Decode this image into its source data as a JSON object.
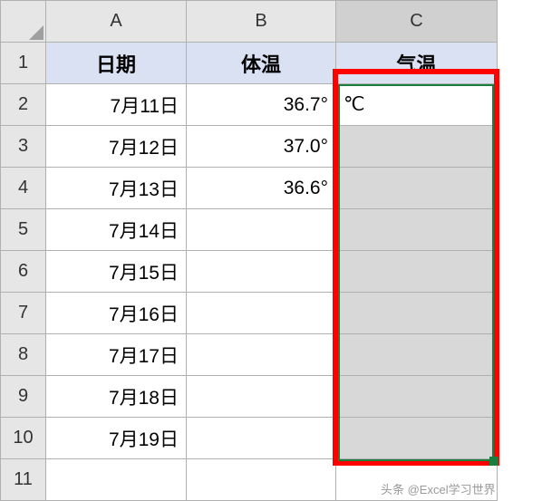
{
  "columns": {
    "A": "A",
    "B": "B",
    "C": "C"
  },
  "rows": [
    "1",
    "2",
    "3",
    "4",
    "5",
    "6",
    "7",
    "8",
    "9",
    "10",
    "11"
  ],
  "headers": {
    "date": "日期",
    "temp": "体温",
    "weather": "气温"
  },
  "data": {
    "r2": {
      "date": "7月11日",
      "temp": "36.7°",
      "weather": "℃"
    },
    "r3": {
      "date": "7月12日",
      "temp": "37.0°",
      "weather": ""
    },
    "r4": {
      "date": "7月13日",
      "temp": "36.6°",
      "weather": ""
    },
    "r5": {
      "date": "7月14日",
      "temp": "",
      "weather": ""
    },
    "r6": {
      "date": "7月15日",
      "temp": "",
      "weather": ""
    },
    "r7": {
      "date": "7月16日",
      "temp": "",
      "weather": ""
    },
    "r8": {
      "date": "7月17日",
      "temp": "",
      "weather": ""
    },
    "r9": {
      "date": "7月18日",
      "temp": "",
      "weather": ""
    },
    "r10": {
      "date": "7月19日",
      "temp": "",
      "weather": ""
    }
  },
  "watermark": "头条 @Excel学习世界"
}
